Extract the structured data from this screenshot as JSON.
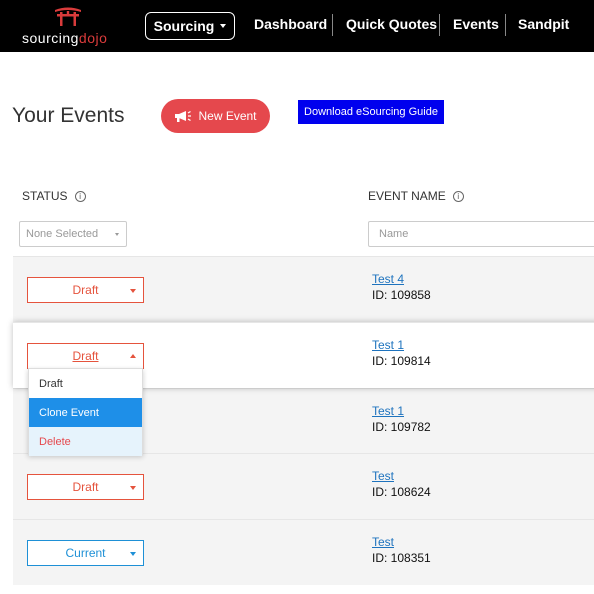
{
  "brand": {
    "name_part1": "sourcing",
    "name_part2": "dojo",
    "accent": "#d93b3b"
  },
  "nav": {
    "sourcing_label": "Sourcing",
    "links": [
      "Dashboard",
      "Quick Quotes",
      "Events",
      "Sandpit"
    ]
  },
  "header": {
    "title": "Your Events",
    "new_event_label": "New Event",
    "guide_label": "Download eSourcing Guide"
  },
  "columns": {
    "status": "STATUS",
    "event_name": "EVENT NAME"
  },
  "filters": {
    "status_selected": "None Selected",
    "name_placeholder": "Name"
  },
  "events": [
    {
      "status": "Draft",
      "name": "Test 4",
      "id": "ID: 109858"
    },
    {
      "status": "Draft",
      "name": "Test 1",
      "id": "ID: 109814"
    },
    {
      "status": "",
      "name": "Test 1",
      "id": "ID: 109782"
    },
    {
      "status": "Draft",
      "name": "Test",
      "id": "ID: 108624"
    },
    {
      "status": "Current",
      "name": "Test",
      "id": "ID: 108351"
    }
  ],
  "dropdown_menu": {
    "items": [
      "Draft",
      "Clone Event",
      "Delete"
    ],
    "active": "Clone Event"
  },
  "colors": {
    "draft": "#e5533d",
    "current": "#1e90d6",
    "new_event": "#e5484d",
    "guide": "#0000ee"
  },
  "icons": {
    "brand": "torii-gate-icon",
    "new_event": "megaphone-icon",
    "info": "info-icon"
  }
}
